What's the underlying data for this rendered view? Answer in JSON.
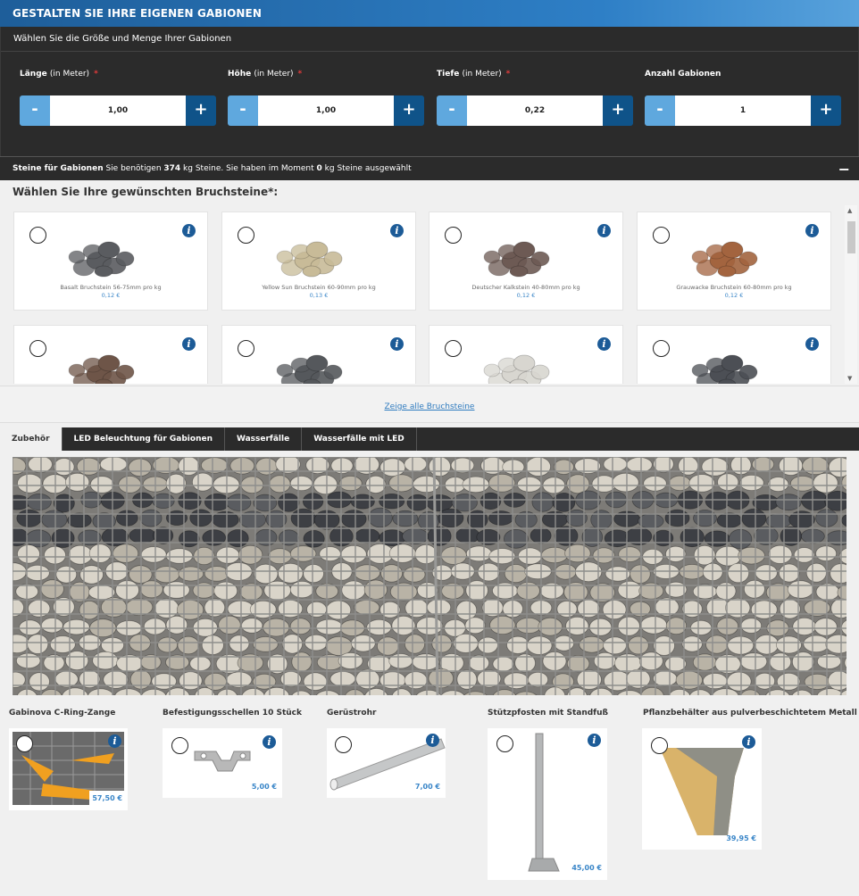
{
  "header": {
    "title": "GESTALTEN SIE IHRE EIGENEN GABIONEN"
  },
  "config": {
    "subtitle": "Wählen Sie die Größe und Menge Ihrer Gabionen",
    "fields": [
      {
        "label": "Länge",
        "unit": "(in Meter)",
        "required": "*",
        "value": "1,00"
      },
      {
        "label": "Höhe",
        "unit": "(in Meter)",
        "required": "*",
        "value": "1,00"
      },
      {
        "label": "Tiefe",
        "unit": "(in Meter)",
        "required": "*",
        "value": "0,22"
      },
      {
        "label": "Anzahl Gabionen",
        "unit": "",
        "required": "",
        "value": "1"
      }
    ],
    "minus": "-",
    "plus": "+"
  },
  "stones_bar": {
    "title": "Steine für Gabionen",
    "text1": " Sie benötigen ",
    "kg_needed": "374",
    "text2": " kg Steine. Sie haben im Moment ",
    "kg_selected": "0",
    "text3": " kg Steine ausgewählt",
    "collapse": "−"
  },
  "stone_section": {
    "title": "Wählen Sie Ihre gewünschten Bruchsteine*:",
    "info": "i",
    "stones": [
      {
        "name": "Basalt Bruchstein 56-75mm pro kg",
        "price": "0,12 €",
        "color": "#5a5c60"
      },
      {
        "name": "Yellow Sun Bruchstein 60-90mm pro kg",
        "price": "0,13 €",
        "color": "#c8bb98"
      },
      {
        "name": "Deutscher Kalkstein 40-80mm pro kg",
        "price": "0,12 €",
        "color": "#6d5a54"
      },
      {
        "name": "Grauwacke Bruchstein 60-80mm pro kg",
        "price": "0,12 €",
        "color": "#a3643f"
      },
      {
        "name": "",
        "price": "",
        "color": "#6e5548"
      },
      {
        "name": "",
        "price": "",
        "color": "#55585c"
      },
      {
        "name": "",
        "price": "",
        "color": "#d8d6d0"
      },
      {
        "name": "",
        "price": "",
        "color": "#4c4f55"
      }
    ],
    "show_all": "Zeige alle Bruchsteine"
  },
  "tabs": [
    "Zubehör",
    "LED Beleuchtung für Gabionen",
    "Wasserfälle",
    "Wasserfälle mit LED"
  ],
  "accessories": [
    {
      "title": "Gabinova C-Ring-Zange",
      "price": "57,50 €"
    },
    {
      "title": "Befestigungsschellen 10 Stück",
      "price": "5,00 €"
    },
    {
      "title": "Gerüstrohr",
      "price": "7,00 €"
    },
    {
      "title": "Stützpfosten mit Standfuß",
      "price": "45,00 €"
    },
    {
      "title": "Pflanzbehälter aus pulverbeschichtetem Metall",
      "price": "39,95 €"
    }
  ],
  "colors": {
    "accent": "#1c5b97",
    "plus": "#0f5389",
    "minus": "#5fa8de",
    "dark": "#2b2b2b",
    "link": "#2f7bbf"
  }
}
